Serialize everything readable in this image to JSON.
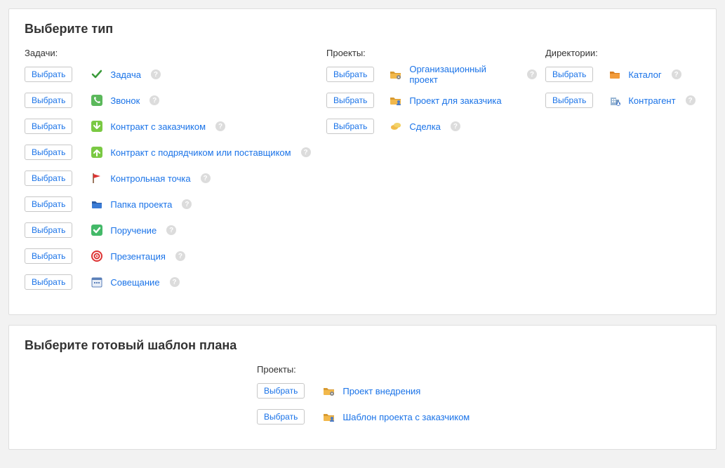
{
  "select_label": "Выбрать",
  "help_glyph": "?",
  "type_panel": {
    "title": "Выберите тип",
    "tasks": {
      "header": "Задачи:",
      "items": [
        {
          "label": "Задача",
          "icon": "check"
        },
        {
          "label": "Звонок",
          "icon": "phone"
        },
        {
          "label": "Контракт с заказчиком",
          "icon": "arrow-down-green"
        },
        {
          "label": "Контракт с подрядчиком или поставщиком",
          "icon": "arrow-up-green"
        },
        {
          "label": "Контрольная точка",
          "icon": "flag"
        },
        {
          "label": "Папка проекта",
          "icon": "folder-blue"
        },
        {
          "label": "Поручение",
          "icon": "tick-green"
        },
        {
          "label": "Презентация",
          "icon": "target"
        },
        {
          "label": "Совещание",
          "icon": "calendar"
        }
      ]
    },
    "projects": {
      "header": "Проекты:",
      "items": [
        {
          "label": "Организационный проект",
          "icon": "folder-gear"
        },
        {
          "label": "Проект для заказчика",
          "icon": "folder-person"
        },
        {
          "label": "Сделка",
          "icon": "coins"
        }
      ]
    },
    "directories": {
      "header": "Директории:",
      "items": [
        {
          "label": "Каталог",
          "icon": "folder-orange"
        },
        {
          "label": "Контрагент",
          "icon": "building"
        }
      ]
    }
  },
  "template_panel": {
    "title": "Выберите готовый шаблон плана",
    "projects": {
      "header": "Проекты:",
      "items": [
        {
          "label": "Проект внедрения",
          "icon": "folder-gear"
        },
        {
          "label": "Шаблон проекта с заказчиком",
          "icon": "folder-person"
        }
      ]
    }
  }
}
